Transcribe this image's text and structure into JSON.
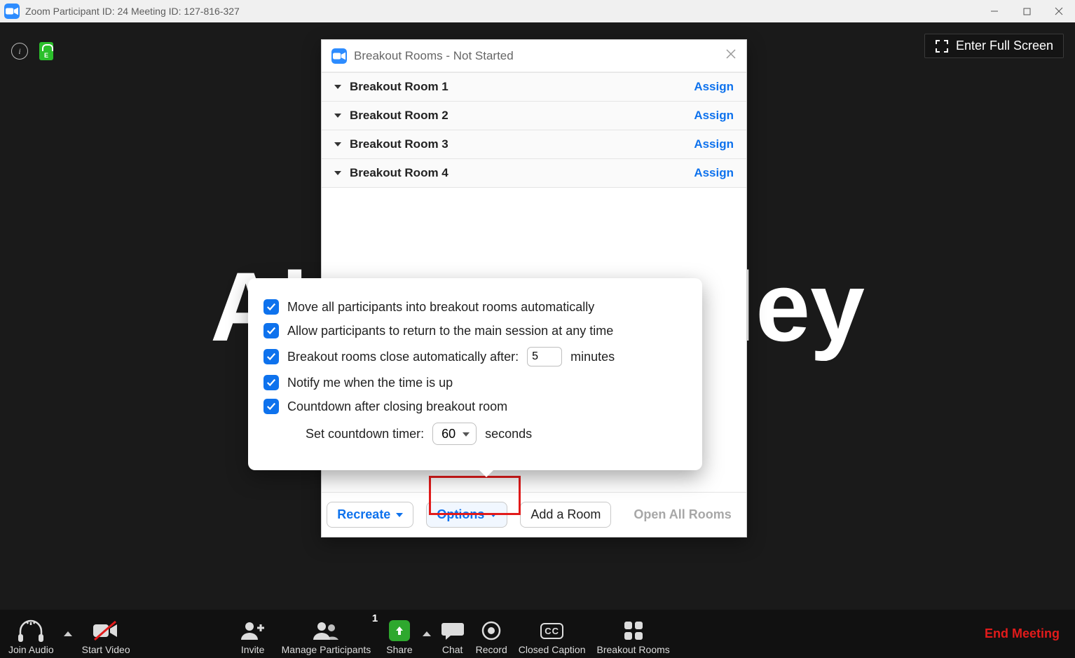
{
  "titlebar": {
    "text": "Zoom Participant ID: 24   Meeting ID: 127-816-327"
  },
  "overlay": {
    "fullscreen_label": "Enter Full Screen"
  },
  "participant_name": "Alexa Brierley",
  "breakout": {
    "title": "Breakout Rooms - Not Started",
    "assign_label": "Assign",
    "rooms": [
      {
        "name": "Breakout Room 1"
      },
      {
        "name": "Breakout Room 2"
      },
      {
        "name": "Breakout Room 3"
      },
      {
        "name": "Breakout Room 4"
      }
    ],
    "footer": {
      "recreate": "Recreate",
      "options": "Options",
      "add_room": "Add a Room",
      "open_all": "Open All Rooms"
    }
  },
  "options": {
    "opt1": "Move all participants into breakout rooms automatically",
    "opt2": "Allow participants to return to the main session at any time",
    "opt3_pre": "Breakout rooms close automatically after:",
    "opt3_value": "5",
    "opt3_post": "minutes",
    "opt4": "Notify me when the time is up",
    "opt5": "Countdown after closing breakout room",
    "countdown_label": "Set countdown timer:",
    "countdown_value": "60",
    "countdown_unit": "seconds"
  },
  "toolbar": {
    "join_audio": "Join Audio",
    "start_video": "Start Video",
    "invite": "Invite",
    "manage_participants": "Manage Participants",
    "participants_count": "1",
    "share": "Share",
    "chat": "Chat",
    "record": "Record",
    "closed_caption": "Closed Caption",
    "cc_text": "CC",
    "breakout_rooms": "Breakout Rooms",
    "end_meeting": "End Meeting"
  }
}
